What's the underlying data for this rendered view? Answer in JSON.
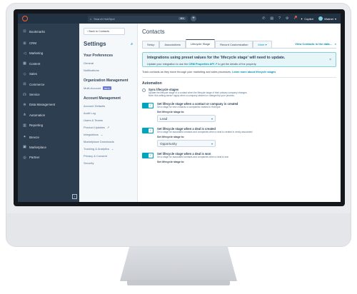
{
  "topbar": {
    "search_placeholder": "Search HubSpot",
    "shortcut": "⌘K",
    "copilot_label": "Copilot",
    "account_label": "Vitalnet"
  },
  "sidebar": {
    "items": [
      {
        "label": "Bookmarks",
        "icon": "bookmark-icon"
      },
      {
        "label": "CRM",
        "icon": "crm-icon"
      },
      {
        "label": "Marketing",
        "icon": "megaphone-icon"
      },
      {
        "label": "Content",
        "icon": "content-icon"
      },
      {
        "label": "Sales",
        "icon": "sales-icon"
      },
      {
        "label": "Commerce",
        "icon": "cart-icon"
      },
      {
        "label": "Service",
        "icon": "service-icon"
      },
      {
        "label": "Data Management",
        "icon": "database-icon"
      },
      {
        "label": "Automation",
        "icon": "automation-icon"
      },
      {
        "label": "Reporting",
        "icon": "chart-icon"
      },
      {
        "label": "Breeze",
        "icon": "breeze-icon"
      },
      {
        "label": "Marketplace",
        "icon": "store-icon"
      },
      {
        "label": "Partner",
        "icon": "partner-icon"
      }
    ]
  },
  "settings_nav": {
    "back_label": "‹ Back to Contacts",
    "title": "Settings",
    "sections": [
      {
        "title": "Your Preferences",
        "items": [
          {
            "label": "General"
          },
          {
            "label": "Notifications"
          }
        ]
      },
      {
        "title": "Organization Management",
        "items": [
          {
            "label": "Multi-Account",
            "badge": "BETA"
          }
        ]
      },
      {
        "title": "Account Management",
        "items": [
          {
            "label": "Account Defaults"
          },
          {
            "label": "Audit Log"
          },
          {
            "label": "Users & Teams"
          },
          {
            "label": "Product Updates",
            "ext": "↗"
          },
          {
            "label": "Integrations",
            "ext": "⌄"
          },
          {
            "label": "Marketplace Downloads"
          },
          {
            "label": "Tracking & Analytics",
            "ext": "⌄"
          },
          {
            "label": "Privacy & Consent"
          },
          {
            "label": "Security"
          }
        ]
      }
    ]
  },
  "main": {
    "title": "Contacts",
    "tabs": [
      {
        "label": "Setup"
      },
      {
        "label": "Associations"
      },
      {
        "label": "Lifecycle Stage"
      },
      {
        "label": "Record Customization"
      },
      {
        "label": "More ▾"
      }
    ],
    "active_tab": 2,
    "view_link": "View Contacts in the data…",
    "banner": {
      "title": "Integrations using preset values for the 'lifecycle stage' will need to update.",
      "text_before": "Update your integration to use the",
      "link": "CRM Properties API ↗",
      "text_after": "to get the details of the property."
    },
    "track_text": "Track contacts as they move through your marketing and sales processes.",
    "track_link": "Learn more about lifecycle stages",
    "automation_label": "Automation",
    "sync": {
      "title": "Sync lifecycle stages",
      "desc1": "Update the lifecycle stage of a contact when the lifecycle stage of their primary company changes.",
      "desc2": "Note: this setting doesn't apply when a company cleared or changed by your process."
    },
    "rules": [
      {
        "title": "Set lifecycle stage when a contact or company is created",
        "desc": "Set a stage for new contacts or companies created in HubSpot",
        "stage_label": "Set lifecycle stage to",
        "value": "Lead"
      },
      {
        "title": "Set lifecycle stage when a deal is created",
        "desc": "Set a stage for associated contacts and companies when a deal is created in newly associated",
        "stage_label": "Set lifecycle stage to",
        "value": "Opportunity"
      },
      {
        "title": "Set lifecycle stage when a deal is won",
        "desc": "Set a stage for associated contacts and companies when a deal is won",
        "stage_label": "Set lifecycle stage to",
        "value": ""
      }
    ]
  }
}
